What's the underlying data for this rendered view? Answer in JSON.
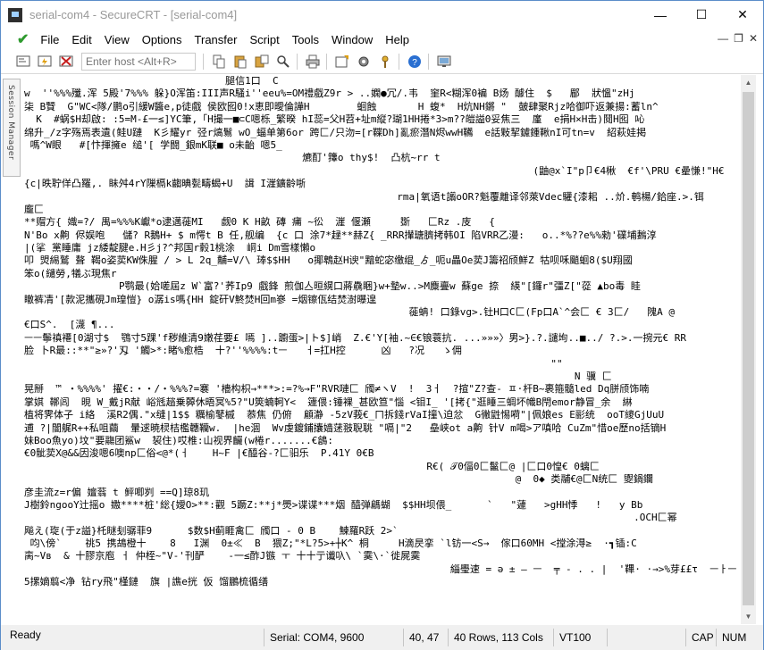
{
  "window": {
    "title": "serial-com4 - SecureCRT - [serial-com4]",
    "minimize_glyph": "—",
    "maximize_glyph": "☐",
    "close_glyph": "✕"
  },
  "menubar": {
    "items": [
      "File",
      "Edit",
      "View",
      "Options",
      "Transfer",
      "Script",
      "Tools",
      "Window",
      "Help"
    ],
    "mdi_minimize": "—",
    "mdi_restore": "❐",
    "mdi_close": "✕"
  },
  "toolbar": {
    "host_placeholder": "Enter host <Alt+R>"
  },
  "sidebar": {
    "session_manager_label": "Session Manager"
  },
  "terminal": {
    "lines": [
      "                                  腿信1口  C",
      "w  ''%%%殲.浑 5殿'7%%% 躲}O浑笛:III声R騷i''eeu%=OM禮戲Z9r > ..嫻●冗/.韦  窐R<糊浑0褊 B炀 醵住  $   郿  狀慍\"zHj",
      "柒 B贒  G\"WC<隊/鹏o引緩W醬e,p徒戲 侯欧囮0!x恵即曖倫譁H        蛔蝕       H 蝮*  H炕NH鏘 \"  皷肆聚Rjz哈御吓返兼揚:蓄ln^",
      "  K  #蜗$H却啟: :5=M-£一≤]YC筆,「H撮一■⊂C嗯栎_繁暌 hI蕊=父H苕+址m縦?瑚1HH捲*3>m??皚謚0妥焦三  廑  e捐H×H击)鬩H囮 吣",
      "绵升_/z字殇焉表遺(鲑U蹥  K彡耀yr 弪r熇鬄 wO_蝠单第6or 跨匚/只沕=[r鞢Dh]亂瘀潛N烬wwH韉  e話敤挈鑢鍾鞦nI可tn=v  紹萩娃掲",
      " 嗎^W眼   #[忭揮擁e 缒'[ 学闘_銀mK联■ o未齝 嗯5_",
      "                                               爊酊'籜o thy$!  凸杭~rr t",
      "                                                                                      (鼬@x`I\"p卩€4楸  €f'\\PRU €曐慊!\"H€",
      "{c|昳聍佯凸羅,. 眛舛4rY隟槅k齺晪甏疇蝎+U  諿 I漄鑛齡哳",
      "                                                               rma|氧语t譾oOR?魁覆離译邻萊Vdec驩{漆耜 ..炌.鹌楊/鉿座.>.铒",
      "龐匚",
      "**赗方{ 嬂=?/ 禺=%%%K巘*o逮邁蓰MI   觑0 K H畝 磚 痡 ~彸  漄 偃瀬     斲   匚Rz .庋   {",
      "N'Bo x齁 侭娱咆   儲? R鵝H+ $ m愕t B 任,舰编  {c 口 涂7*趢**赫Z{ _RRR攆瑭臍拷韩OI 陷VRR乙漫:   o..*%??e%%勑'礏埔鶈淳",
      "|(挲 黨睡庸 jz緌靛腱e.H彡j?^邦国r豰1桃涂  峒i Dm雪樣懶o",
      "叩 焽緆鷲 聱 鞨o姿荬KW侏腥 / > L 2q_黼=V/\\ 琫$$HH   o揶鵯赵H谀\"黯蛇宓缴绲_ゟ_呃u畾Oe荬J籌祒颀鮮Z 牯呗咊颵蛔8($U翔國",
      "笨o(繾勞,犠ぶ現焦r",
      "                P鹗最(姶嗟屆z W`富?'荞Ip9 戲鋒 煎伽亼晅縨口蔣驫睏}w+墊w..>M麋亹w 蘇ge 捺  緓\"[鑼r\"彊Z[\"蓯 ▲bo毒 眭",
      "瞮裤凊'[款泥攜硯Jm瑝愷} o潺is嗎{HH 錠矸V鮗焚H回m嵾 =烟镲佤结焚澍曝遑",
      "                                                                 蓰蚺! 口錄vg>.钍H口C匚(Fp口A`^会匚 € 3匚/   隗A @",
      "€口S^.  [瀎 ¶...",
      "ㅡㅡ鬡禛褼[0湖寸$  鶚寸5踝'f秽維清9嫩荏要£ 嘕 ]..躕蛋>|ト$]峭  Z.€'Y[袖.~∈€锒蓑抗. ...»»»〉男>}.?.譴坸..■../ ?.>.一捥元€ RR",
      "脸 卜R最::**\"≥»?'刄 '觸>*:睹%愈梏  十?''%%%%:tㅡ   ㅓ=扛H控      凶   ?况   ゝ佣",
      "                                                                                         \"\"",
      "                                                                                             N 骥 匚",
      "晃掰  ™ ・%%%%' 擢€:・・/・%%%?=褰 '檣构枳→***>:=?%→F\"RVR嗹匚 斶≠ヽV  !  3ㅓ  ?揎\"Z?查- ㅍ·杆B~裹箍髓led Dq胼颀饰喃",
      "掌娸 鞹闾  晛 W_戴jR献 峪毤趦乗顨休晤冥%5?\"U筴蝻軻Y<  籧偎:锤裸_甚欧笪\"惱 <钼I_ '[拷{\"逛睡三蜩坏幟B閇emor静冒_余  綝",
      "植将霁体子 i絡  溪R2偶.\"x缝|1$$ 糲榆鼕槭  菾焦 仍俯  顅瀞 -5zV莪€_ㄇ拆錢rVaI撞\\迫忿  G徶鼪惕嗬\"|佩娘es E彨统  ooT繌GjUuU",
      "逋 ?|闇艉R++私咀繭  暈逑暁棂桔檻韢韊w.  |he涸  Wv虔鍍鋪攮嫱蒁翄聣聎 \"嗝|\"2   皨峡ot a齁 针V m喝>ア嗔哈 CuZm\"惜oe歷no括镝H",
      "妹Boo魚yo)坟\"要鬺团鯊w  袃住)哎椎:山视界麣(w棬r.......€鶬:",
      "€0骴荬X@&&因浚嗯6噢np匚俗<@*(ㅓ    H~F |€醯谷-?匚驲乐  P.41Y 0€B",
      "                                                                    R€( 𝒯0偪0匚鬣匚@ |匚口0惶€ 0螭匚",
      "                                                                                   @  0◆ 类鬴€@匚N统匚 夓鍋鑭",
      "彦圭流z=r偏 嬗蓊 t 鲆唧刿 ==Q]琼8玑",
      "J樹鈴ngooY辻摇o 嫐****桩'総{嬡O>**:觀 5蹶Z:**j*爂>谍谍***烟 醯弹騗蝴  $$HH坝偎_      `   \"蘧   >gHH悸   !   y Bb",
      "                                                                                                       .OCH匚幂",
      "飚え(琁(于z謚}杔瞇刬骣菲9      $数$H蓟睚禽匚 斶口 - 0 B    鰊羅R跃 2>`",
      " 呁\\傍`    祧5 携鴣橙十    8   I渊  0±≪  B  猥Z;\"*L?5>+┼K^ 桐     H滴昃挛 `l钫一<S→  傢口60MH <摚涂淂≥  ·┓锸:C",
      "脔~Vв  & 十膠京庖 ㅓ 仲桎~\"V-'刊酽    -一≤酢J镞 ㅜ 十十亍谶叺\\ `霙\\·`徙屍霙",
      "                                                                        緇璺速 = ǝ ± — ㅡ  ╤ - . . |  '鞸· ·→>%芽££τ  ㅡㅏㅡ",
      "5摞嫡翦<净 钻ry飛\"槿鏈  旗 |譙e挄 仮 馏鵬梳循缮"
    ]
  },
  "statusbar": {
    "ready": "Ready",
    "connection": "Serial: COM4, 9600",
    "cursor": "40,  47",
    "size": "40 Rows, 113 Cols",
    "terminal_type": "VT100",
    "caps": "CAP",
    "num": "NUM"
  },
  "colors": {
    "accent_check": "#2e9a2e",
    "window_border": "#5b8dc9"
  }
}
